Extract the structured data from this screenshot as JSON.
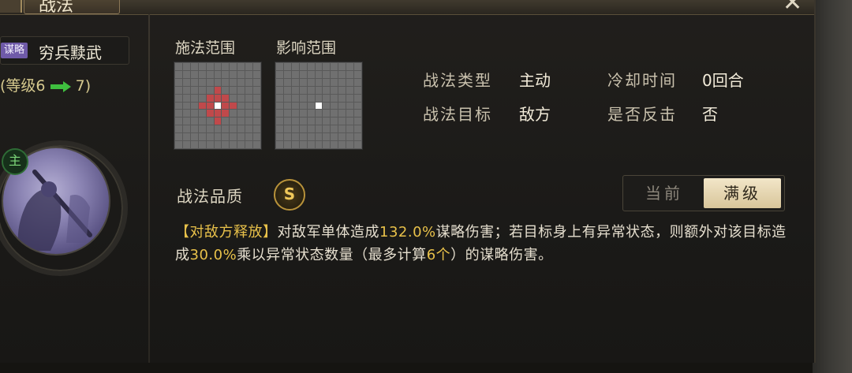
{
  "window": {
    "title": "战法"
  },
  "skill": {
    "tag": "谋略",
    "name": "穷兵黩武",
    "level_prefix": "(等级6",
    "level_suffix": "7)",
    "main_badge": "主"
  },
  "range": {
    "cast_label": "施法范围",
    "effect_label": "影响范围",
    "cast_grid": {
      "size": 11,
      "center": [
        5,
        5
      ],
      "highlight": [
        [
          3,
          5
        ],
        [
          4,
          4
        ],
        [
          4,
          5
        ],
        [
          4,
          6
        ],
        [
          5,
          3
        ],
        [
          5,
          4
        ],
        [
          5,
          6
        ],
        [
          5,
          7
        ],
        [
          6,
          4
        ],
        [
          6,
          5
        ],
        [
          6,
          6
        ],
        [
          7,
          5
        ]
      ]
    },
    "effect_grid": {
      "size": 11,
      "center": [
        5,
        5
      ],
      "highlight": []
    }
  },
  "info": {
    "type_label": "战法类型",
    "type_value": "主动",
    "cooldown_label": "冷却时间",
    "cooldown_value": "0回合",
    "target_label": "战法目标",
    "target_value": "敌方",
    "counter_label": "是否反击",
    "counter_value": "否"
  },
  "quality": {
    "label": "战法品质",
    "grade": "S"
  },
  "toggle": {
    "current_label": "当前",
    "max_label": "满级",
    "selected": "max"
  },
  "description": {
    "trigger": "【对敌方释放】",
    "part1": "对敌军单体造成",
    "value1": "132.0%",
    "part2": "谋略伤害；若目标身上有异常状态，则额外对该目标造成",
    "value2": "30.0%",
    "part3": "乘以异常状态数量（最多计算",
    "value3": "6个",
    "part4": "）的谋略伤害。"
  },
  "colors": {
    "highlight_cell": "#c0494b",
    "accent_text": "#e8c14a",
    "tag_purple": "#6f5aa8",
    "arrow_green": "#3fbf3f"
  },
  "icons": {
    "close": "close-icon",
    "arrow": "green-arrow-icon"
  }
}
